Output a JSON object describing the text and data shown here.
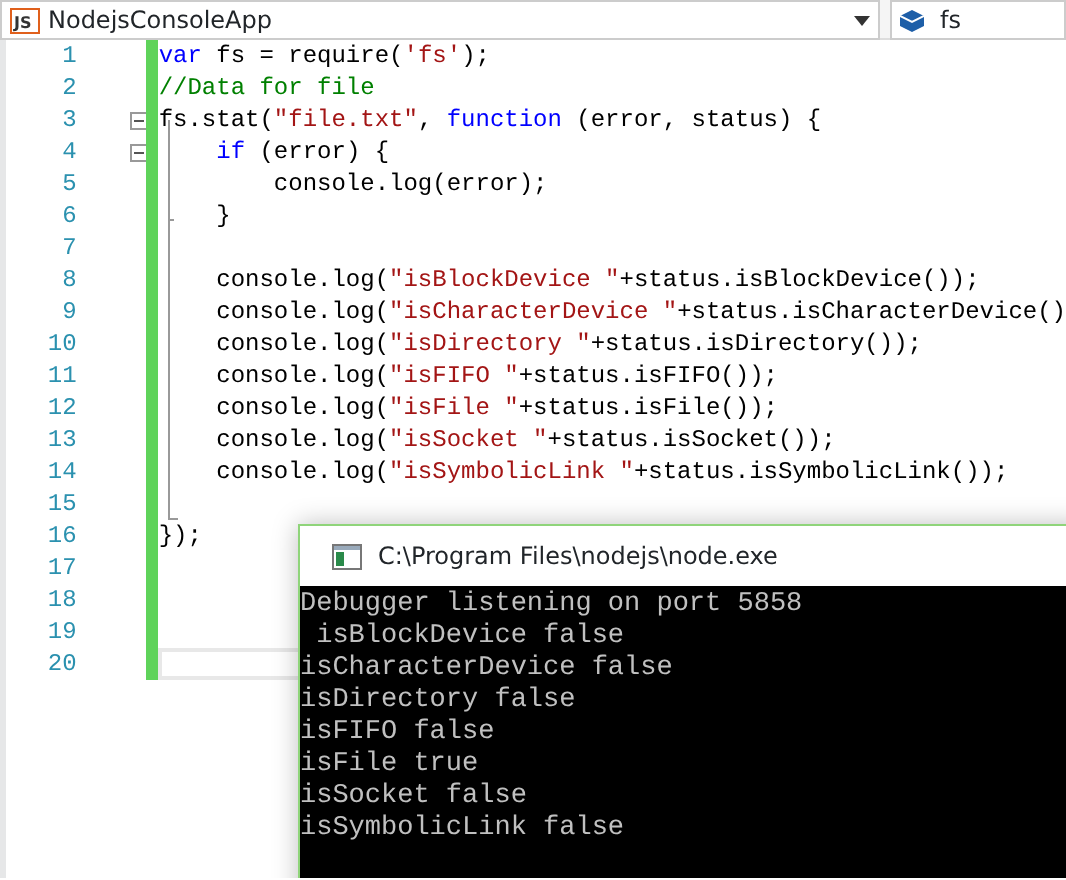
{
  "toolbar": {
    "project_dropdown": {
      "icon_text": "JS",
      "label": "NodejsConsoleApp"
    },
    "member_dropdown": {
      "label": "fs"
    }
  },
  "code_lines": [
    {
      "number": "1",
      "current": false,
      "tokens": [
        {
          "kind": "keyword",
          "text": "var"
        },
        {
          "kind": "plain",
          "text": " fs = require("
        },
        {
          "kind": "string",
          "text": "'fs'"
        },
        {
          "kind": "plain",
          "text": ");"
        }
      ]
    },
    {
      "number": "2",
      "current": false,
      "tokens": [
        {
          "kind": "comment",
          "text": "//Data for file"
        }
      ]
    },
    {
      "number": "3",
      "current": false,
      "expanded": true,
      "tokens": [
        {
          "kind": "plain",
          "text": "fs.stat("
        },
        {
          "kind": "string",
          "text": "\"file.txt\""
        },
        {
          "kind": "plain",
          "text": ", "
        },
        {
          "kind": "keyword",
          "text": "function"
        },
        {
          "kind": "plain",
          "text": " (error, status) {"
        }
      ]
    },
    {
      "number": "4",
      "current": false,
      "expanded": true,
      "tokens": [
        {
          "kind": "keyword",
          "text": "    if"
        },
        {
          "kind": "plain",
          "text": " (error) {"
        }
      ]
    },
    {
      "number": "5",
      "current": false,
      "tokens": [
        {
          "kind": "plain",
          "text": "        console.log(error);"
        }
      ]
    },
    {
      "number": "6",
      "current": false,
      "tokens": [
        {
          "kind": "plain",
          "text": "    }"
        }
      ]
    },
    {
      "number": "7",
      "current": false
    },
    {
      "number": "8",
      "current": false,
      "tokens": [
        {
          "kind": "plain",
          "text": "    console.log("
        },
        {
          "kind": "string",
          "text": "\"isBlockDevice \""
        },
        {
          "kind": "plain",
          "text": "+status.isBlockDevice());"
        }
      ]
    },
    {
      "number": "9",
      "current": false,
      "tokens": [
        {
          "kind": "plain",
          "text": "    console.log("
        },
        {
          "kind": "string",
          "text": "\"isCharacterDevice \""
        },
        {
          "kind": "plain",
          "text": "+status.isCharacterDevice()"
        }
      ]
    },
    {
      "number": "10",
      "current": false,
      "tokens": [
        {
          "kind": "plain",
          "text": "    console.log("
        },
        {
          "kind": "string",
          "text": "\"isDirectory \""
        },
        {
          "kind": "plain",
          "text": "+status.isDirectory());"
        }
      ]
    },
    {
      "number": "11",
      "current": false,
      "tokens": [
        {
          "kind": "plain",
          "text": "    console.log("
        },
        {
          "kind": "string",
          "text": "\"isFIFO \""
        },
        {
          "kind": "plain",
          "text": "+status.isFIFO());"
        }
      ]
    },
    {
      "number": "12",
      "current": false,
      "tokens": [
        {
          "kind": "plain",
          "text": "    console.log("
        },
        {
          "kind": "string",
          "text": "\"isFile \""
        },
        {
          "kind": "plain",
          "text": "+status.isFile());"
        }
      ]
    },
    {
      "number": "13",
      "current": false,
      "tokens": [
        {
          "kind": "plain",
          "text": "    console.log("
        },
        {
          "kind": "string",
          "text": "\"isSocket \""
        },
        {
          "kind": "plain",
          "text": "+status.isSocket());"
        }
      ]
    },
    {
      "number": "14",
      "current": false,
      "tokens": [
        {
          "kind": "plain",
          "text": "    console.log("
        },
        {
          "kind": "string",
          "text": "\"isSymbolicLink \""
        },
        {
          "kind": "plain",
          "text": "+status.isSymbolicLink());"
        }
      ]
    },
    {
      "number": "15",
      "current": false
    },
    {
      "number": "16",
      "current": false,
      "tokens": [
        {
          "kind": "plain",
          "text": "});"
        }
      ]
    },
    {
      "number": "17",
      "current": false
    },
    {
      "number": "18",
      "current": false
    },
    {
      "number": "19",
      "current": false
    },
    {
      "number": "20",
      "current": true
    }
  ],
  "console_window": {
    "title": "C:\\Program Files\\nodejs\\node.exe",
    "output": [
      "Debugger listening on port 5858",
      " isBlockDevice false",
      "isCharacterDevice false",
      "isDirectory false",
      "isFIFO false",
      "isFile true",
      "isSocket false",
      "isSymbolicLink false"
    ]
  }
}
